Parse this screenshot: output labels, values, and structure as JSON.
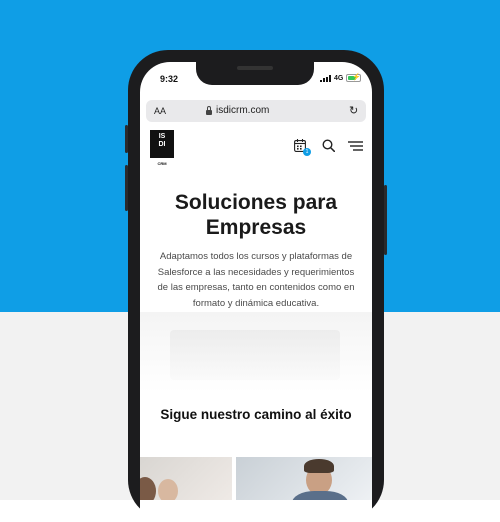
{
  "status_bar": {
    "time": "9:32",
    "network": "4G"
  },
  "browser": {
    "text_size_label": "AA",
    "url": "isdicrm.com"
  },
  "site_header": {
    "logo_text_line1": "IS",
    "logo_text_line2": "DI",
    "logo_sub": "CRM",
    "calendar_badge": "1"
  },
  "hero": {
    "title": "Soluciones para Empresas",
    "text": "Adaptamos todos los cursos y plataformas de Salesforce a las necesidades y requerimientos de las empresas, tanto en contenidos como en formato y dinámica educativa."
  },
  "section": {
    "title": "Sigue nuestro camino al éxito"
  },
  "colors": {
    "background_top": "#0f9ee6",
    "background_bottom": "#f2f2f2",
    "accent": "#0f9ee6"
  }
}
